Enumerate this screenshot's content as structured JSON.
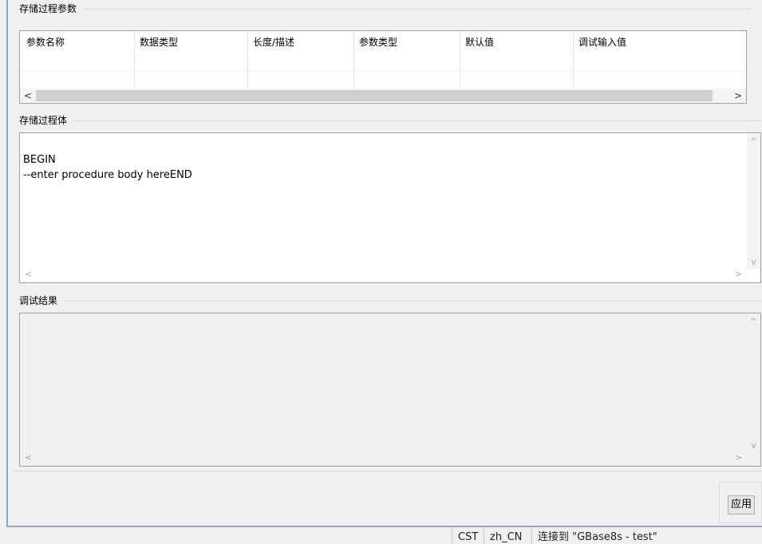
{
  "params_section": {
    "title": "存储过程参数",
    "columns": [
      "参数名称",
      "数据类型",
      "长度/描述",
      "参数类型",
      "默认值",
      "调试输入值"
    ],
    "scroll_left": "<",
    "scroll_right": ">"
  },
  "body_section": {
    "title": "存储过程体",
    "code_line1": "BEGIN",
    "code_line2": "--enter procedure body hereEND",
    "scroll_up": "^",
    "scroll_down": "v",
    "scroll_left": "<",
    "scroll_right": ">"
  },
  "result_section": {
    "title": "调试结果",
    "scroll_up": "^",
    "scroll_down": "v",
    "scroll_left": "<",
    "scroll_right": ">"
  },
  "apply_button": "应用",
  "status_bar": {
    "timezone": "CST",
    "locale": "zh_CN",
    "connection": "连接到 \"GBase8s - test\""
  }
}
